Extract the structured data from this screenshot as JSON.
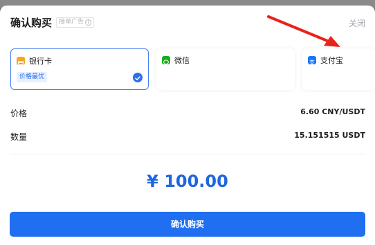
{
  "header": {
    "title": "确认购买",
    "ad_tag": "接单广告",
    "close_label": "关闭"
  },
  "payment_methods": [
    {
      "label": "银行卡",
      "badge": "价格最优",
      "selected": true,
      "icon": "bank-card-icon",
      "color": "#f5a623"
    },
    {
      "label": "微信",
      "selected": false,
      "icon": "wechat-icon",
      "color": "#1aad19"
    },
    {
      "label": "支付宝",
      "selected": false,
      "icon": "alipay-icon",
      "color": "#1677ff"
    }
  ],
  "details": {
    "price_label": "价格",
    "price_value": "6.60 CNY/USDT",
    "quantity_label": "数量",
    "quantity_value": "15.151515 USDT"
  },
  "amount": "¥ 100.00",
  "confirm_button": "确认购买",
  "colors": {
    "accent": "#1f6ff0",
    "annotation_arrow": "#e8231a"
  }
}
